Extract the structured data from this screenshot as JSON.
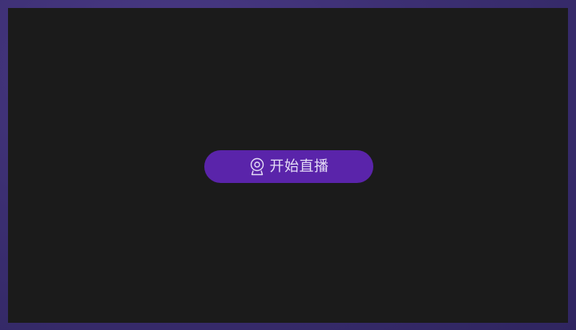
{
  "stream": {
    "start_button_label": "开始直播",
    "start_button_icon": "webcam-icon"
  },
  "colors": {
    "background_outer": "#3c2f72",
    "panel": "#1b1b1b",
    "button": "#5a24aa",
    "button_text": "#e4dcf6"
  }
}
